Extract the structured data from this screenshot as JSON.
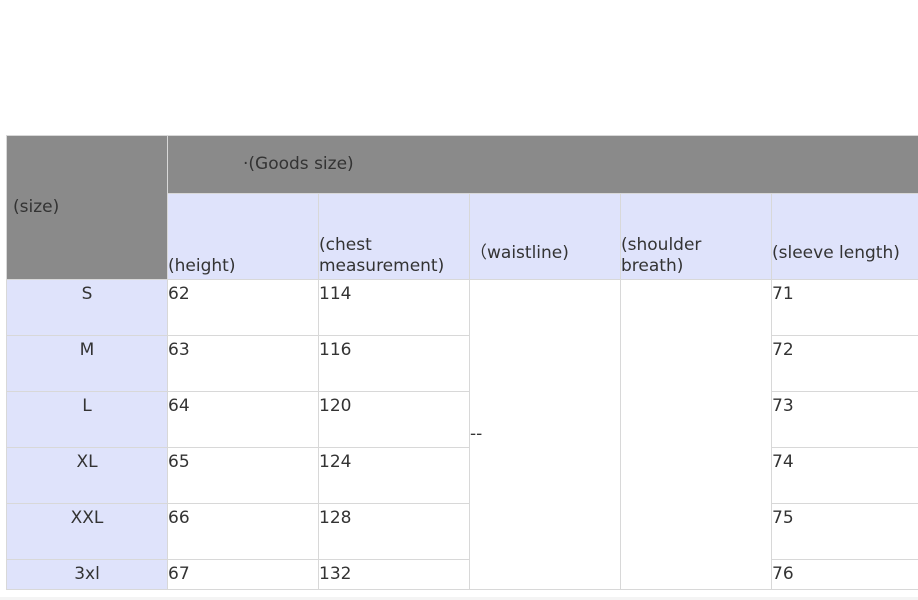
{
  "table": {
    "corner_label": "(size)",
    "group_header": "·(Goods size)",
    "columns": [
      "(height)",
      "(chest\nmeasurement)",
      "（waistline)",
      "(shoulder\nbreath)",
      "(sleeve length)"
    ],
    "rows": [
      {
        "size": "S",
        "height": "62",
        "chest": "114",
        "sleeve": "71"
      },
      {
        "size": "M",
        "height": "63",
        "chest": "116",
        "sleeve": "72"
      },
      {
        "size": "L",
        "height": "64",
        "chest": "120",
        "sleeve": "73"
      },
      {
        "size": "XL",
        "height": "65",
        "chest": "124",
        "sleeve": "74"
      },
      {
        "size": "XXL",
        "height": "66",
        "chest": "128",
        "sleeve": "75"
      },
      {
        "size": "3xl",
        "height": "67",
        "chest": "132",
        "sleeve": "76"
      }
    ],
    "waistline_value": "--",
    "shoulder_value": ""
  },
  "colors": {
    "header_gray": "#8a8a8a",
    "header_lavender": "#dfe3fb",
    "border": "#d8d8d8"
  }
}
